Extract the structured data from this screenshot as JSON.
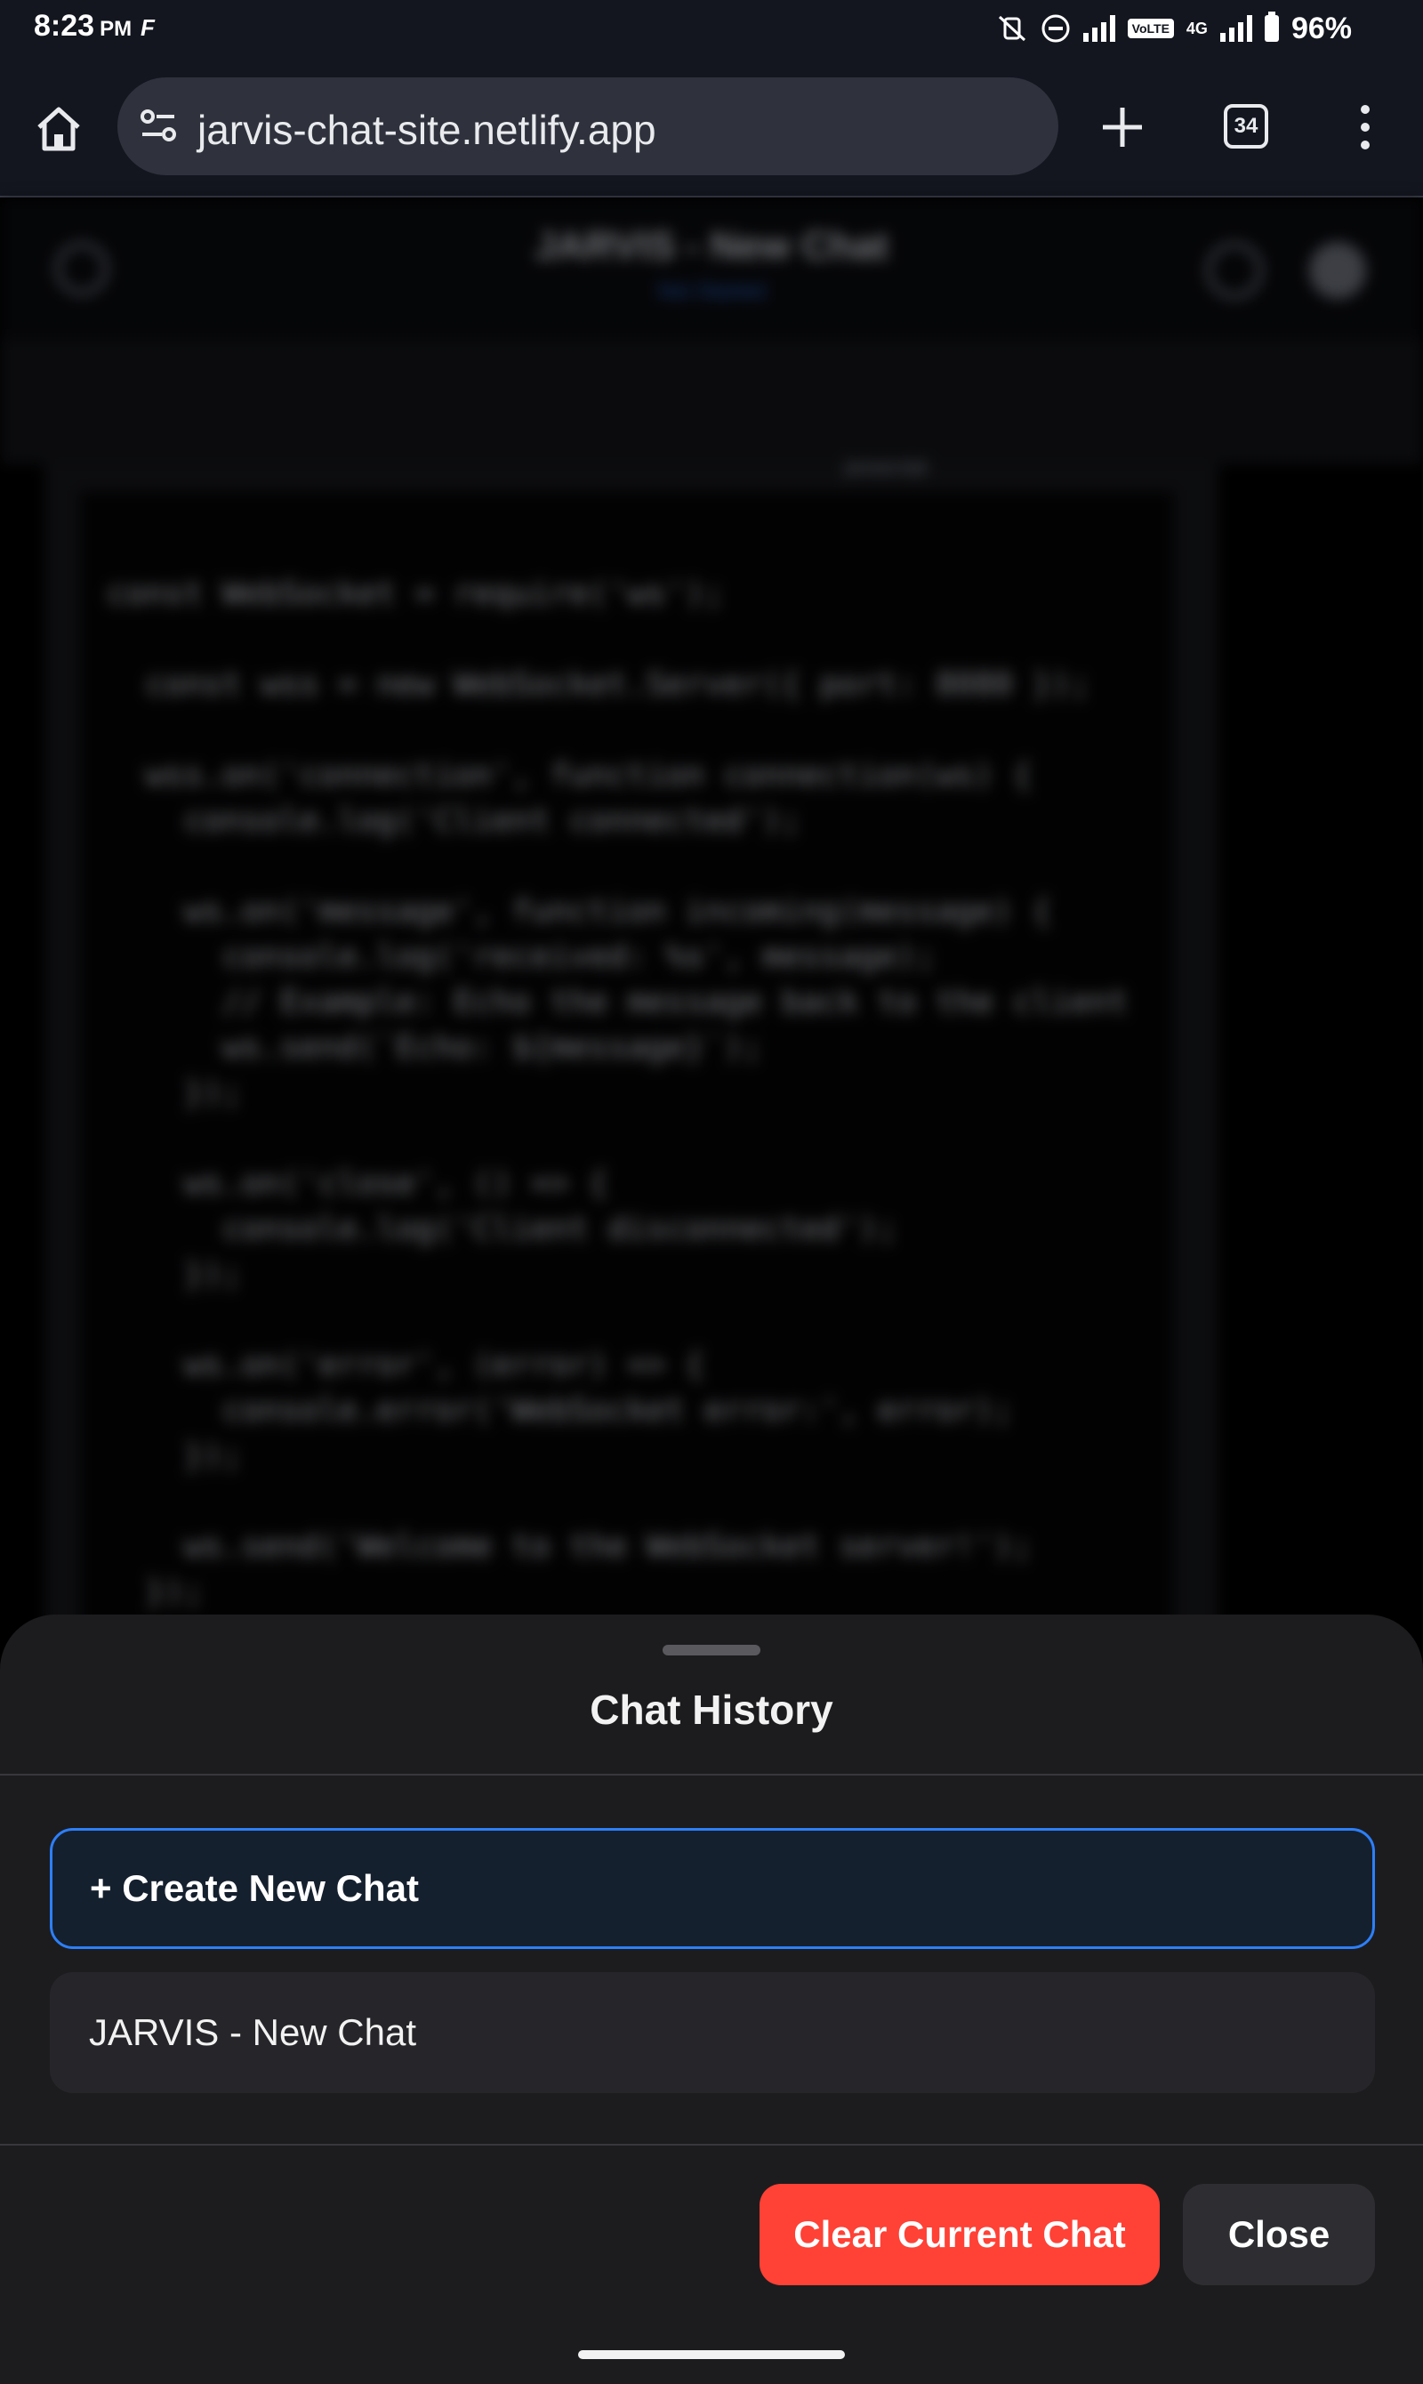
{
  "status_bar": {
    "time": "8:23",
    "ampm": "PM",
    "carrier_glyph": "F",
    "network_label": "VoLTE",
    "network_gen": "4G",
    "battery": "96%",
    "icons": [
      "mute-vibrate-icon",
      "do-not-disturb-icon",
      "signal-icon",
      "battery-icon"
    ]
  },
  "browser": {
    "url": "jarvis-chat-site.netlify.app",
    "tab_count": "34",
    "icons": [
      "home-icon",
      "site-info-icon",
      "plus-icon",
      "more-vert-icon"
    ]
  },
  "background_app": {
    "title": "JARVIS - New Chat",
    "status": "Not Started",
    "code_language": "javascript",
    "code": "const WebSocket = require('ws');\n\n  const wss = new WebSocket.Server({ port: 8080 });\n\n  wss.on('connection', function connection(ws) {\n    console.log('Client connected');\n\n    ws.on('message', function incoming(message) {\n      console.log('received: %s', message);\n      // Example: Echo the message back to the client\n      ws.send(`Echo: ${message}`);\n    });\n\n    ws.on('close', () => {\n      console.log('Client disconnected');\n    });\n\n    ws.on('error', (error) => {\n      console.error('WebSocket error:', error);\n    });\n\n    ws.send('Welcome to the WebSocket server!');\n  });"
  },
  "sheet": {
    "title": "Chat History",
    "create_label": "+ Create New Chat",
    "chats": [
      "JARVIS - New Chat"
    ],
    "clear_label": "Clear Current Chat",
    "close_label": "Close"
  },
  "colors": {
    "accent": "#2d7ff9",
    "danger": "#ff4136",
    "sheet_bg": "#1c1c1e"
  }
}
